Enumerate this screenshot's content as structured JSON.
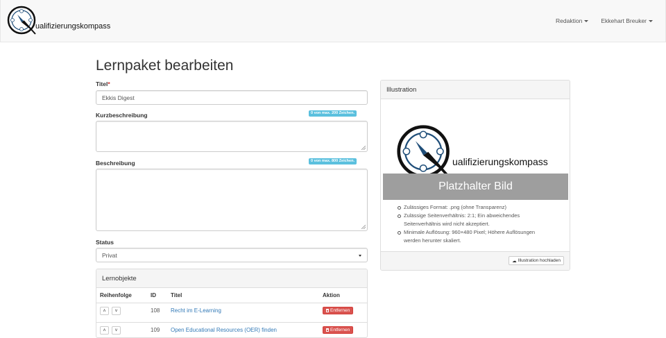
{
  "navbar": {
    "brand_text": "ualifizierungskompass",
    "menu_redaktion": "Redaktion",
    "menu_user": "Ekkehart Breuker"
  },
  "page": {
    "title": "Lernpaket bearbeiten"
  },
  "form": {
    "titel_label": "Titel",
    "titel_required_mark": "*",
    "titel_value": "Ekkis Digest",
    "kurz_label": "Kurzbeschreibung",
    "kurz_counter": "0 von max. 200 Zeichen.",
    "kurz_value": "",
    "beschreibung_label": "Beschreibung",
    "beschreibung_counter": "0 von max. 800 Zeichen.",
    "beschreibung_value": "",
    "status_label": "Status",
    "status_value": "Privat"
  },
  "lernobjekte": {
    "heading": "Lernobjekte",
    "columns": [
      "Reihenfolge",
      "ID",
      "Titel",
      "Aktion"
    ],
    "rows": [
      {
        "id": "108",
        "titel": "Recht im E-Learning",
        "aktion": "Entfernen"
      },
      {
        "id": "109",
        "titel": "Open Educational Resources (OER) finden",
        "aktion": "Entfernen"
      }
    ]
  },
  "illustration": {
    "heading": "Illustration",
    "logo_text": "ualifizierungskompass",
    "placeholder": "Platzhalter Bild",
    "hints": [
      "Zulässiges Format: .png (ohne Transparenz)",
      "Zulässige Seitenverhältnis: 2:1; Ein abweichendes",
      "Seitenverhältnis wird nicht akzeptiert.",
      "Minimale Auflösung: 960×480 Pixel; Höhere Auflösungen",
      "werden herunter skaliert."
    ],
    "upload_button": "Illustration hochladen"
  },
  "colors": {
    "accent": "#5bc0de",
    "danger": "#d9534f",
    "link": "#337ab7"
  }
}
